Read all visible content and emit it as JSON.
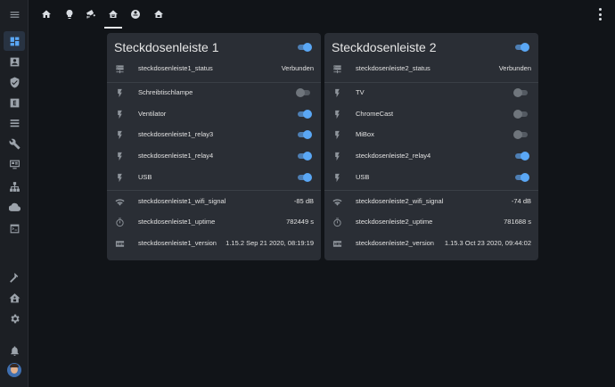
{
  "topbar": {
    "tabs": [
      {
        "icon": "home-icon"
      },
      {
        "icon": "lightbulb-icon"
      },
      {
        "icon": "cctv-icon"
      },
      {
        "icon": "home-automation-icon",
        "active": true
      },
      {
        "icon": "robot-vacuum-icon"
      },
      {
        "icon": "home-floor-icon"
      }
    ],
    "menu_icon": "dots-vertical-icon"
  },
  "sidebar": {
    "items": [
      {
        "icon": "menu-icon"
      },
      {
        "icon": "dashboard-icon",
        "active": true
      },
      {
        "icon": "account-box-icon"
      },
      {
        "icon": "shield-check-icon"
      },
      {
        "icon": "alpha-e-box-icon"
      },
      {
        "icon": "list-icon"
      },
      {
        "icon": "wrench-icon"
      },
      {
        "icon": "monitor-dashboard-icon"
      },
      {
        "icon": "sitemap-icon"
      },
      {
        "icon": "cloud-icon"
      },
      {
        "icon": "console-icon"
      },
      {
        "icon": "hammer-icon"
      },
      {
        "icon": "home-assistant-icon"
      },
      {
        "icon": "cog-icon"
      },
      {
        "icon": "bell-icon"
      }
    ]
  },
  "cards": [
    {
      "title": "Steckdosenleiste 1",
      "header_toggle_on": true,
      "status": {
        "label": "steckdosenleiste1_status",
        "value": "Verbunden"
      },
      "switches": [
        {
          "label": "Schreibtischlampe",
          "on": false
        },
        {
          "label": "Ventilator",
          "on": true
        },
        {
          "label": "steckdosenleiste1_relay3",
          "on": true
        },
        {
          "label": "steckdosenleiste1_relay4",
          "on": true
        },
        {
          "label": "USB",
          "on": true
        }
      ],
      "sensors": [
        {
          "label": "steckdosenleiste1_wifi_signal",
          "value": "-85 dB",
          "icon": "wifi-icon"
        },
        {
          "label": "steckdosenleiste1_uptime",
          "value": "782449 s",
          "icon": "timer-icon"
        },
        {
          "label": "steckdosenleiste1_version",
          "value": "1.15.2 Sep 21 2020, 08:19:19",
          "icon": "new-box-icon"
        }
      ]
    },
    {
      "title": "Steckdosenleiste 2",
      "header_toggle_on": true,
      "status": {
        "label": "steckdosenleiste2_status",
        "value": "Verbunden"
      },
      "switches": [
        {
          "label": "TV",
          "on": false
        },
        {
          "label": "ChromeCast",
          "on": false
        },
        {
          "label": "MiBox",
          "on": false
        },
        {
          "label": "steckdosenleiste2_relay4",
          "on": true
        },
        {
          "label": "USB",
          "on": true
        }
      ],
      "sensors": [
        {
          "label": "steckdosenleiste2_wifi_signal",
          "value": "-74 dB",
          "icon": "wifi-icon"
        },
        {
          "label": "steckdosenleiste2_uptime",
          "value": "781688 s",
          "icon": "timer-icon"
        },
        {
          "label": "steckdosenleiste2_version",
          "value": "1.15.3 Oct 23 2020, 09:44:02",
          "icon": "new-box-icon"
        }
      ]
    }
  ]
}
